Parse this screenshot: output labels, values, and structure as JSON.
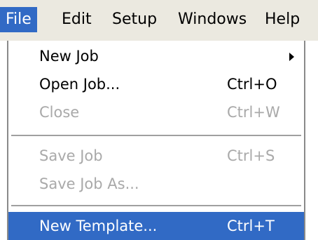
{
  "menubar": {
    "items": [
      {
        "label": "File"
      },
      {
        "label": "Edit"
      },
      {
        "label": "Setup"
      },
      {
        "label": "Windows"
      },
      {
        "label": "Help"
      }
    ]
  },
  "file_menu": {
    "items": [
      {
        "label": "New Job",
        "shortcut": "",
        "submenu_icon": "submenu-arrow-icon"
      },
      {
        "label": "Open Job...",
        "shortcut": "Ctrl+O"
      },
      {
        "label": "Close",
        "shortcut": "Ctrl+W",
        "disabled": true
      },
      {
        "label": "Save Job",
        "shortcut": "Ctrl+S",
        "disabled": true
      },
      {
        "label": "Save Job As...",
        "shortcut": "",
        "disabled": true
      },
      {
        "label": "New Template...",
        "shortcut": "Ctrl+T",
        "highlighted": true
      }
    ]
  },
  "colors": {
    "highlight": "#316ac5",
    "menubar_bg": "#ebe9e0",
    "disabled_text": "#a9a9a9"
  }
}
